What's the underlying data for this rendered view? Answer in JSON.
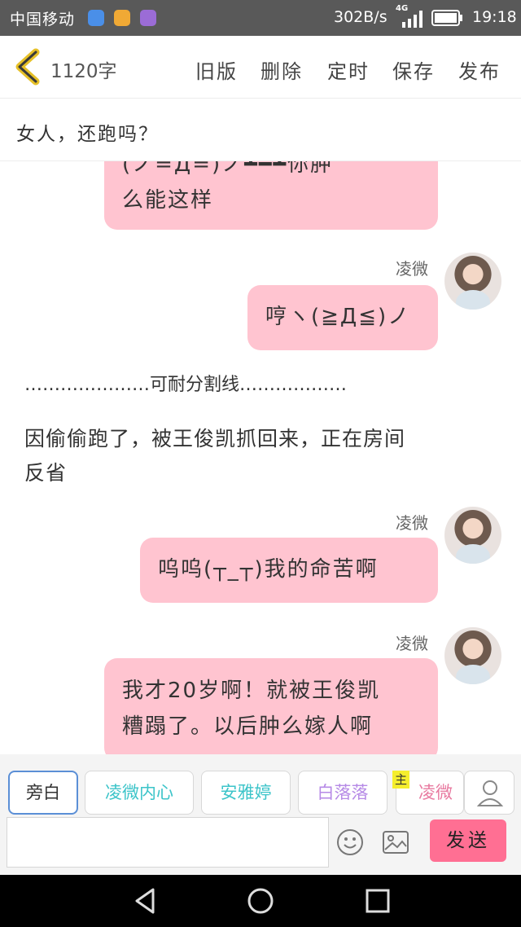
{
  "status_bar": {
    "carrier": "中国移动",
    "net_speed": "302B/s",
    "network": "4G",
    "time": "19:18"
  },
  "header": {
    "word_count": "1120字",
    "buttons": {
      "old_version": "旧版",
      "delete": "删除",
      "schedule": "定时",
      "save": "保存",
      "publish": "发布"
    }
  },
  "story_title": "女人，还跑吗？",
  "chat": {
    "messages": [
      {
        "kind": "bubble",
        "line1": "(ノ=Д=)ノ┻━┻你肿",
        "line2": "么能这样"
      },
      {
        "kind": "bubble",
        "user": "凌微",
        "line1": "哼ヽ(≧Д≦)ノ"
      },
      {
        "kind": "narration",
        "text": "…………………可耐分割线………………"
      },
      {
        "kind": "narration",
        "line1": "因偷偷跑了，被王俊凯抓回来，正在房间",
        "line2": "反省"
      },
      {
        "kind": "bubble",
        "user": "凌微",
        "line1": "呜呜(┬_┬)我的命苦啊"
      },
      {
        "kind": "bubble",
        "user": "凌微",
        "line1": "我才20岁啊！就被王俊凯",
        "line2": "糟蹋了。以后肿么嫁人啊"
      }
    ]
  },
  "roles": [
    {
      "label": "旁白",
      "color": "#333333"
    },
    {
      "label": "凌微内心",
      "color": "#3cc4c9"
    },
    {
      "label": "安雅婷",
      "color": "#3cc4c9"
    },
    {
      "label": "白落落",
      "color": "#b68ae6"
    },
    {
      "label": "凌微",
      "color": "#e87aa0",
      "badge": "主"
    }
  ],
  "input": {
    "placeholder": "",
    "send_label": "发送"
  }
}
